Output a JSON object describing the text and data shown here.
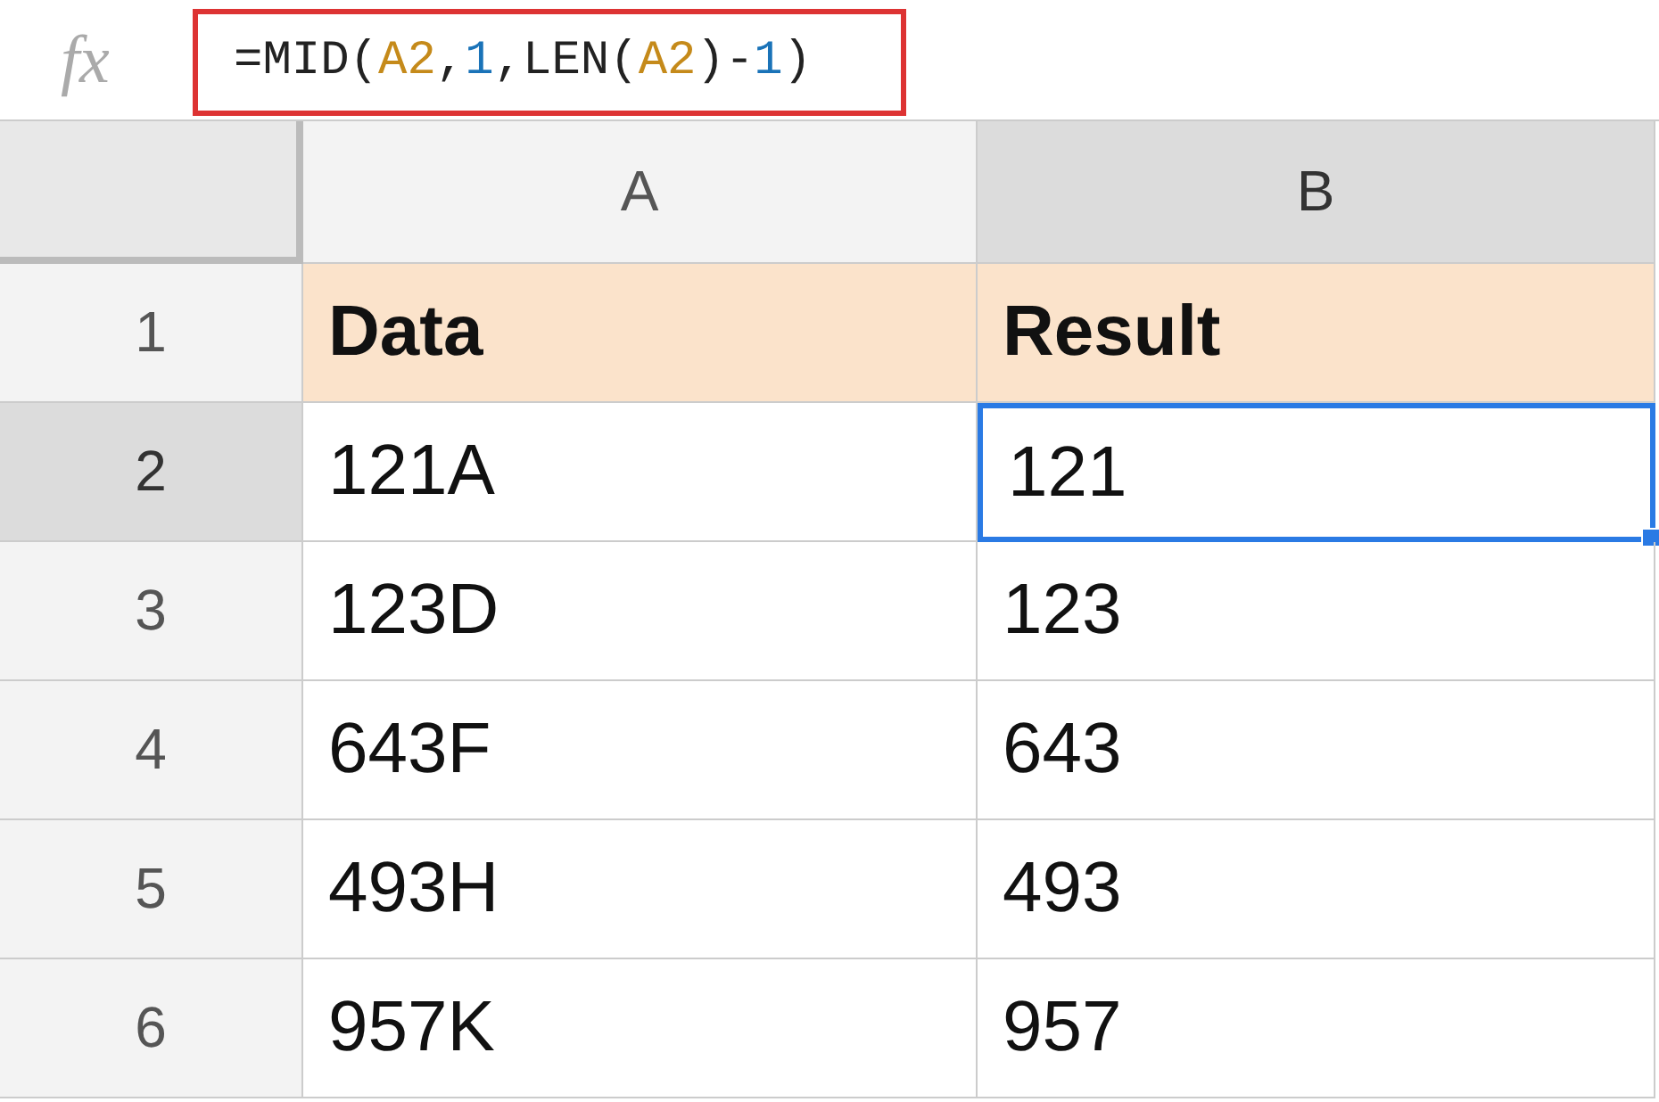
{
  "formula_bar": {
    "icon_text": "fx",
    "formula": [
      {
        "kind": "plain",
        "text": "=MID("
      },
      {
        "kind": "ref",
        "text": "A2"
      },
      {
        "kind": "plain",
        "text": ","
      },
      {
        "kind": "number",
        "text": "1"
      },
      {
        "kind": "plain",
        "text": ",LEN("
      },
      {
        "kind": "ref",
        "text": "A2"
      },
      {
        "kind": "plain",
        "text": ")-"
      },
      {
        "kind": "number",
        "text": "1"
      },
      {
        "kind": "plain",
        "text": ")"
      }
    ]
  },
  "columns": [
    {
      "label": "A",
      "selected": false
    },
    {
      "label": "B",
      "selected": true
    }
  ],
  "rows": [
    {
      "number": "1",
      "selected": false,
      "kind": "header",
      "cells": [
        {
          "text": "Data",
          "selected": false
        },
        {
          "text": "Result",
          "selected": false
        }
      ]
    },
    {
      "number": "2",
      "selected": true,
      "kind": "data",
      "cells": [
        {
          "text": "121A",
          "selected": false
        },
        {
          "text": "121",
          "selected": true
        }
      ]
    },
    {
      "number": "3",
      "selected": false,
      "kind": "data",
      "cells": [
        {
          "text": "123D",
          "selected": false
        },
        {
          "text": "123",
          "selected": false
        }
      ]
    },
    {
      "number": "4",
      "selected": false,
      "kind": "data",
      "cells": [
        {
          "text": "643F",
          "selected": false
        },
        {
          "text": "643",
          "selected": false
        }
      ]
    },
    {
      "number": "5",
      "selected": false,
      "kind": "data",
      "cells": [
        {
          "text": "493H",
          "selected": false
        },
        {
          "text": "493",
          "selected": false
        }
      ]
    },
    {
      "number": "6",
      "selected": false,
      "kind": "data",
      "cells": [
        {
          "text": "957K",
          "selected": false
        },
        {
          "text": "957",
          "selected": false
        }
      ]
    }
  ]
}
